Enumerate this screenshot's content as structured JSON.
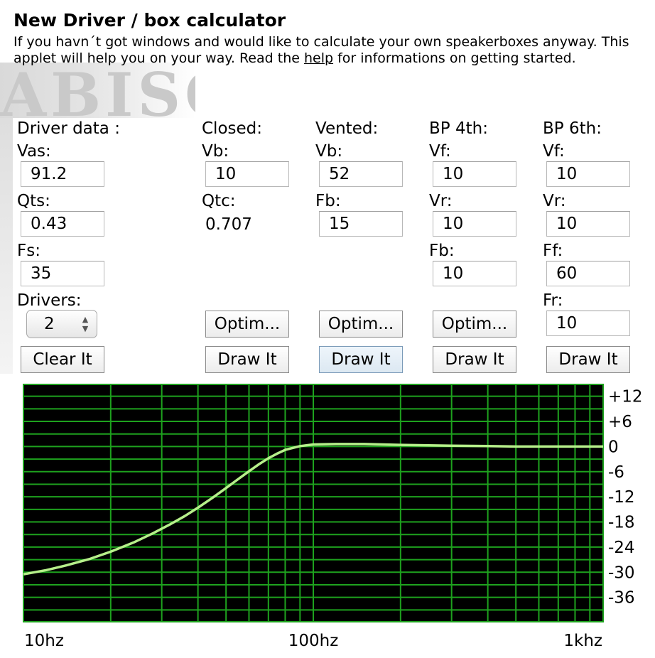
{
  "title": "New Driver / box calculator",
  "intro": {
    "before_link": "If you havn´t got windows and would like to calculate your own speakerboxes anyway. This applet will help you on your way. Read the ",
    "link": "help",
    "after_link": " for informations on getting started."
  },
  "driver": {
    "heading": "Driver data :",
    "vas_label": "Vas:",
    "vas": "91.2",
    "qts_label": "Qts:",
    "qts": "0.43",
    "fs_label": "Fs:",
    "fs": "35",
    "drivers_label": "Drivers:",
    "drivers": "2",
    "clear_button": "Clear It"
  },
  "closed": {
    "heading": "Closed:",
    "vb_label": "Vb:",
    "vb": "10",
    "qtc_label": "Qtc:",
    "qtc": "0.707",
    "optimize_button": "Optim...",
    "draw_button": "Draw It"
  },
  "vented": {
    "heading": "Vented:",
    "vb_label": "Vb:",
    "vb": "52",
    "fb_label": "Fb:",
    "fb": "15",
    "optimize_button": "Optim...",
    "draw_button": "Draw It"
  },
  "bp4": {
    "heading": "BP 4th:",
    "vf_label": "Vf:",
    "vf": "10",
    "vr_label": "Vr:",
    "vr": "10",
    "fb_label": "Fb:",
    "fb": "10",
    "optimize_button": "Optim...",
    "draw_button": "Draw It"
  },
  "bp6": {
    "heading": "BP 6th:",
    "vf_label": "Vf:",
    "vf": "10",
    "vr_label": "Vr:",
    "vr": "10",
    "ff_label": "Ff:",
    "ff": "60",
    "fr_label": "Fr:",
    "fr": "10",
    "draw_button": "Draw It"
  },
  "chart_data": {
    "type": "line",
    "x_scale": "log",
    "xlim": [
      10,
      1000
    ],
    "ylim": [
      -42,
      15
    ],
    "x_tick_labels": [
      "10hz",
      "100hz",
      "1khz"
    ],
    "x_tick_values": [
      10,
      100,
      1000
    ],
    "y_tick_labels": [
      "+12",
      "+6",
      "0",
      "-6",
      "-12",
      "-18",
      "-24",
      "-30",
      "-36"
    ],
    "y_tick_values": [
      12,
      6,
      0,
      -6,
      -12,
      -18,
      -24,
      -30,
      -36
    ],
    "grid": true,
    "background": "#000000",
    "grid_color": "#1ea21e",
    "series": [
      {
        "color": "#b6ef8a",
        "x": [
          10,
          12,
          14,
          17,
          20,
          24,
          28,
          32,
          36,
          40,
          45,
          50,
          55,
          60,
          65,
          70,
          75,
          80,
          90,
          100,
          120,
          150,
          200,
          250,
          300,
          400,
          500,
          700,
          1000
        ],
        "y": [
          -30.5,
          -29.5,
          -28.4,
          -26.8,
          -25.1,
          -22.9,
          -20.7,
          -18.6,
          -16.6,
          -14.6,
          -12.2,
          -9.9,
          -7.8,
          -5.9,
          -4.2,
          -2.8,
          -1.7,
          -0.8,
          0.1,
          0.5,
          0.6,
          0.6,
          0.4,
          0.3,
          0.2,
          0.1,
          0,
          0,
          0
        ]
      }
    ]
  }
}
